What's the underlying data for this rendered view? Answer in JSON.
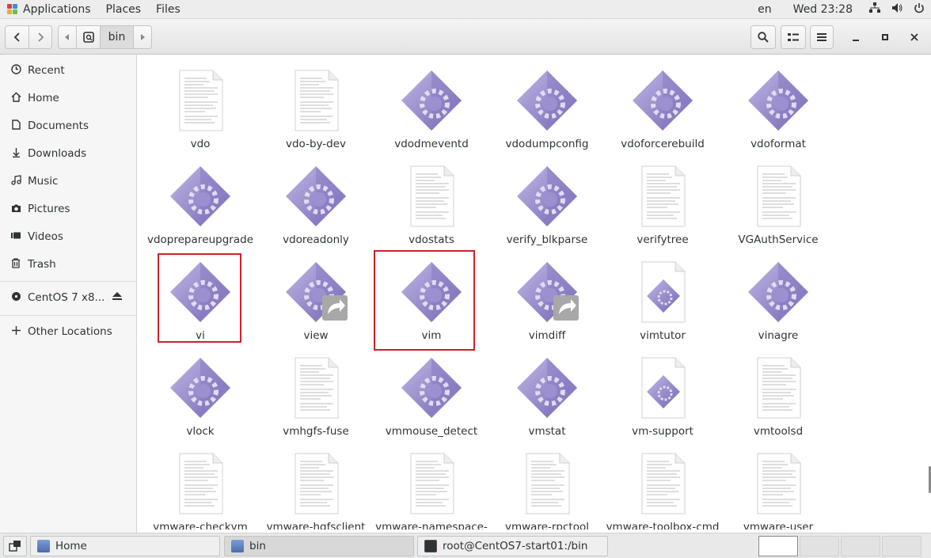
{
  "topbar": {
    "menus": [
      "Applications",
      "Places",
      "Files"
    ],
    "lang": "en",
    "clock": "Wed 23:28"
  },
  "header": {
    "path_label": "bin"
  },
  "sidebar": {
    "items": [
      {
        "label": "Recent",
        "icon": "clock-icon"
      },
      {
        "label": "Home",
        "icon": "home-icon"
      },
      {
        "label": "Documents",
        "icon": "document-icon"
      },
      {
        "label": "Downloads",
        "icon": "download-icon"
      },
      {
        "label": "Music",
        "icon": "music-icon"
      },
      {
        "label": "Pictures",
        "icon": "camera-icon"
      },
      {
        "label": "Videos",
        "icon": "video-icon"
      },
      {
        "label": "Trash",
        "icon": "trash-icon"
      }
    ],
    "device": {
      "label": "CentOS 7 x8...",
      "icon": "disc-icon"
    },
    "other": {
      "label": "Other Locations",
      "icon": "plus-icon"
    }
  },
  "files": [
    {
      "name": "vdo",
      "type": "text"
    },
    {
      "name": "vdo-by-dev",
      "type": "text"
    },
    {
      "name": "vdodmeventd",
      "type": "exec"
    },
    {
      "name": "vdodumpconfig",
      "type": "exec"
    },
    {
      "name": "vdoforcerebuild",
      "type": "exec"
    },
    {
      "name": "vdoformat",
      "type": "exec"
    },
    {
      "name": "vdopreparеupgrade",
      "type": "exec"
    },
    {
      "name": "vdoreadonly",
      "type": "exec"
    },
    {
      "name": "vdostats",
      "type": "text"
    },
    {
      "name": "verify_blkparse",
      "type": "exec"
    },
    {
      "name": "verifytree",
      "type": "text"
    },
    {
      "name": "VGAuthService",
      "type": "text"
    },
    {
      "name": "vi",
      "type": "exec",
      "selected": true
    },
    {
      "name": "view",
      "type": "link"
    },
    {
      "name": "vim",
      "type": "exec",
      "selected": true
    },
    {
      "name": "vimdiff",
      "type": "link"
    },
    {
      "name": "vimtutor",
      "type": "script"
    },
    {
      "name": "vinagre",
      "type": "exec"
    },
    {
      "name": "vlock",
      "type": "exec"
    },
    {
      "name": "vmhgfs-fuse",
      "type": "text"
    },
    {
      "name": "vmmouse_detect",
      "type": "exec"
    },
    {
      "name": "vmstat",
      "type": "exec"
    },
    {
      "name": "vm-support",
      "type": "script"
    },
    {
      "name": "vmtoolsd",
      "type": "text"
    },
    {
      "name": "vmware-checkvm",
      "type": "text"
    },
    {
      "name": "vmware-hgfsclient",
      "type": "text"
    },
    {
      "name": "vmware-namespace-",
      "type": "text"
    },
    {
      "name": "vmware-rpctool",
      "type": "text"
    },
    {
      "name": "vmware-toolbox-cmd",
      "type": "text"
    },
    {
      "name": "vmware-user",
      "type": "text"
    }
  ],
  "taskbar": {
    "tasks": [
      {
        "label": "Home",
        "active": false
      },
      {
        "label": "bin",
        "active": true
      },
      {
        "label": "root@CentOS7-start01:/bin",
        "active": false
      }
    ]
  },
  "colors": {
    "accent_exec": "#8e7fc4",
    "selection_border": "#d0202a"
  }
}
